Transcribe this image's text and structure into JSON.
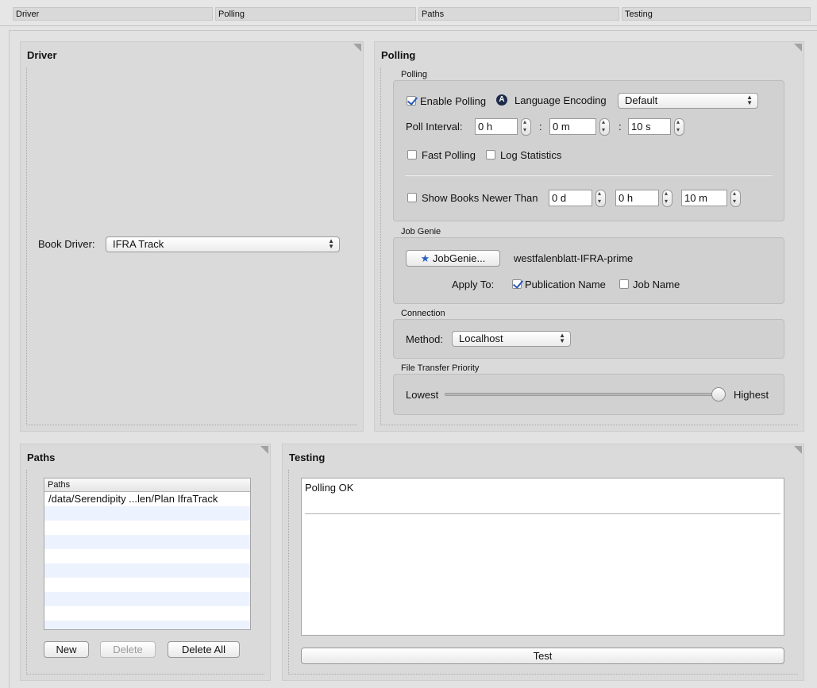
{
  "tabs": [
    "Driver",
    "Polling",
    "Paths",
    "Testing"
  ],
  "driver_panel": {
    "title": "Driver",
    "book_driver_label": "Book Driver:",
    "book_driver_value": "IFRA Track"
  },
  "polling_panel": {
    "title": "Polling",
    "polling_group": {
      "label": "Polling",
      "enable_polling": "Enable Polling",
      "language_encoding_label": "Language Encoding",
      "language_encoding_value": "Default",
      "poll_interval_label": "Poll Interval:",
      "hours": "0 h",
      "minutes": "0 m",
      "seconds": "10 s",
      "colon": ":",
      "fast_polling": "Fast Polling",
      "log_statistics": "Log Statistics",
      "show_books_newer_than": "Show Books Newer Than",
      "newer_days": "0 d",
      "newer_hours": "0 h",
      "newer_minutes": "10 m"
    },
    "job_genie_group": {
      "label": "Job Genie",
      "button": "JobGenie...",
      "job_name_value": "westfalenblatt-IFRA-prime",
      "apply_to_label": "Apply To:",
      "publication_name": "Publication Name",
      "job_name": "Job Name"
    },
    "connection_group": {
      "label": "Connection",
      "method_label": "Method:",
      "method_value": "Localhost"
    },
    "priority_group": {
      "label": "File Transfer Priority",
      "lowest": "Lowest",
      "highest": "Highest",
      "level": 1.0
    }
  },
  "paths_panel": {
    "title": "Paths",
    "column_header": "Paths",
    "rows": [
      "/data/Serendipity ...len/Plan IfraTrack"
    ],
    "new_button": "New",
    "delete_button": "Delete",
    "delete_all_button": "Delete All"
  },
  "testing_panel": {
    "title": "Testing",
    "result_text": "Polling OK",
    "test_button": "Test"
  }
}
